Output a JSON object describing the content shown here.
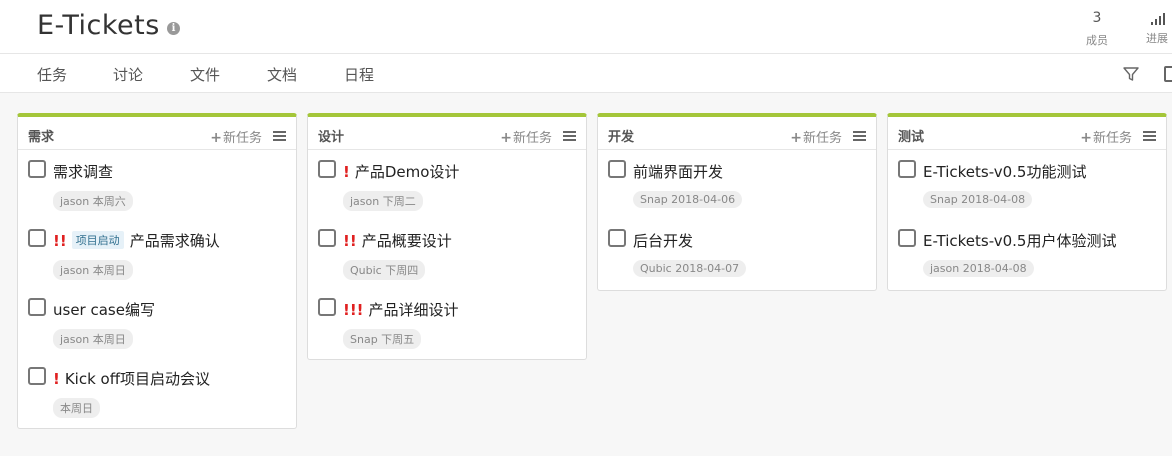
{
  "header": {
    "title": "E-Tickets",
    "members": {
      "count": "3",
      "label": "成员"
    },
    "progress": {
      "label": "进展"
    }
  },
  "tabs": [
    "任务",
    "讨论",
    "文件",
    "文档",
    "日程"
  ],
  "board": {
    "new_task_label": "新任务",
    "columns": [
      {
        "title": "需求",
        "tasks": [
          {
            "priority": "",
            "tag": "",
            "text": "需求调查",
            "meta": "jason 本周六"
          },
          {
            "priority": "!!",
            "tag": "项目启动",
            "text": "产品需求确认",
            "meta": "jason 本周日"
          },
          {
            "priority": "",
            "tag": "",
            "text": "user case编写",
            "meta": "jason 本周日"
          },
          {
            "priority": "!",
            "tag": "",
            "text": "Kick off项目启动会议",
            "meta": "本周日"
          }
        ]
      },
      {
        "title": "设计",
        "tasks": [
          {
            "priority": "!",
            "tag": "",
            "text": "产品Demo设计",
            "meta": "jason 下周二"
          },
          {
            "priority": "!!",
            "tag": "",
            "text": "产品概要设计",
            "meta": "Qubic 下周四"
          },
          {
            "priority": "!!!",
            "tag": "",
            "text": "产品详细设计",
            "meta": "Snap 下周五"
          }
        ]
      },
      {
        "title": "开发",
        "tasks": [
          {
            "priority": "",
            "tag": "",
            "text": "前端界面开发",
            "meta": "Snap 2018-04-06"
          },
          {
            "priority": "",
            "tag": "",
            "text": "后台开发",
            "meta": "Qubic 2018-04-07"
          }
        ]
      },
      {
        "title": "测试",
        "tasks": [
          {
            "priority": "",
            "tag": "",
            "text": "E-Tickets-v0.5功能测试",
            "meta": "Snap 2018-04-08"
          },
          {
            "priority": "",
            "tag": "",
            "text": "E-Tickets-v0.5用户体验测试",
            "meta": "jason 2018-04-08"
          }
        ]
      }
    ]
  },
  "colors": {
    "accent": "#a4c639",
    "priority": "#e02020"
  }
}
